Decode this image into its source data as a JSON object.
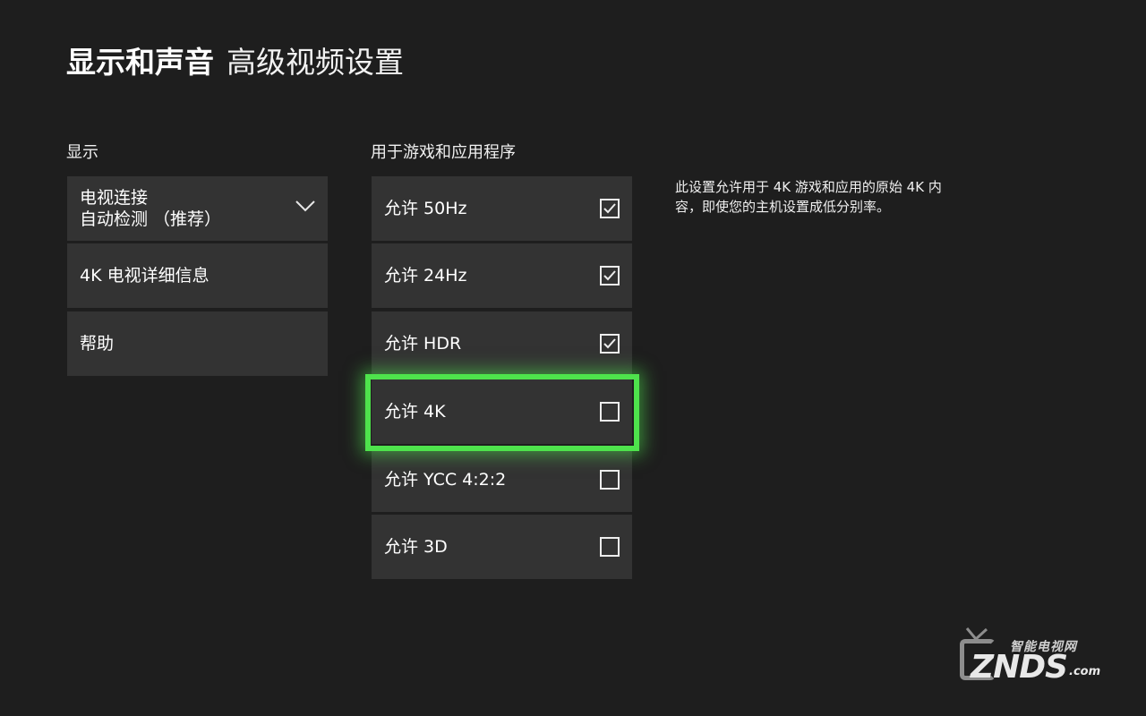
{
  "header": {
    "title_bold": "显示和声音",
    "title_normal": "高级视频设置"
  },
  "display_section": {
    "label": "显示",
    "tv_connection": {
      "title": "电视连接",
      "value": "自动检测 （推荐）",
      "icon": "chevron-down-icon"
    },
    "items": [
      {
        "label": "4K 电视详细信息"
      },
      {
        "label": "帮助"
      }
    ]
  },
  "apps_section": {
    "label": "用于游戏和应用程序",
    "options": [
      {
        "label": "允许 50Hz",
        "checked": true
      },
      {
        "label": "允许 24Hz",
        "checked": true
      },
      {
        "label": "允许 HDR",
        "checked": true
      },
      {
        "label": "允许 4K",
        "checked": false,
        "focused": true
      },
      {
        "label": "允许 YCC 4:2:2",
        "checked": false
      },
      {
        "label": "允许 3D",
        "checked": false
      }
    ]
  },
  "description": "此设置允许用于 4K 游戏和应用的原始 4K 内容，即使您的主机设置成低分别率。",
  "watermark": {
    "brand_cn": "智能电视网",
    "brand_en": "ZNDS",
    "domain": ".com"
  },
  "colors": {
    "background": "#1e1e1e",
    "tile": "#333333",
    "focus": "#4ee34c",
    "text": "#ffffff"
  }
}
